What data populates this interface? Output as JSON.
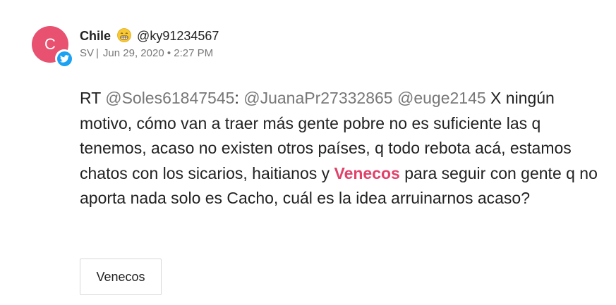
{
  "post": {
    "avatar_letter": "C",
    "avatar_color": "#e8516f",
    "badge_icon": "twitter-bird-icon",
    "badge_color": "#1da1f2",
    "author_name": "Chile",
    "author_emoji": "grimacing-face-icon",
    "handle": "@ky91234567",
    "country": "SV",
    "separator": "|",
    "date": "Jun 29, 2020",
    "dot": "•",
    "time": "2:27 PM",
    "text": {
      "rt": "RT ",
      "mention1": "@Soles61847545",
      "colon": ": ",
      "mention2": "@JuanaPr27332865",
      "space": " ",
      "mention3": "@euge2145",
      "part1": " X ningún motivo, cómo van a traer más gente pobre no es suficiente las q tenemos, acaso no existen otros países, q todo rebota acá, estamos chatos con los sicarios, haitianos y ",
      "keyword": "Venecos",
      "part2": " para seguir con gente q no aporta nada solo es Cacho, cuál es la idea arruinarnos acaso?"
    },
    "keyword_color": "#e0426a",
    "tag_label": "Venecos"
  }
}
